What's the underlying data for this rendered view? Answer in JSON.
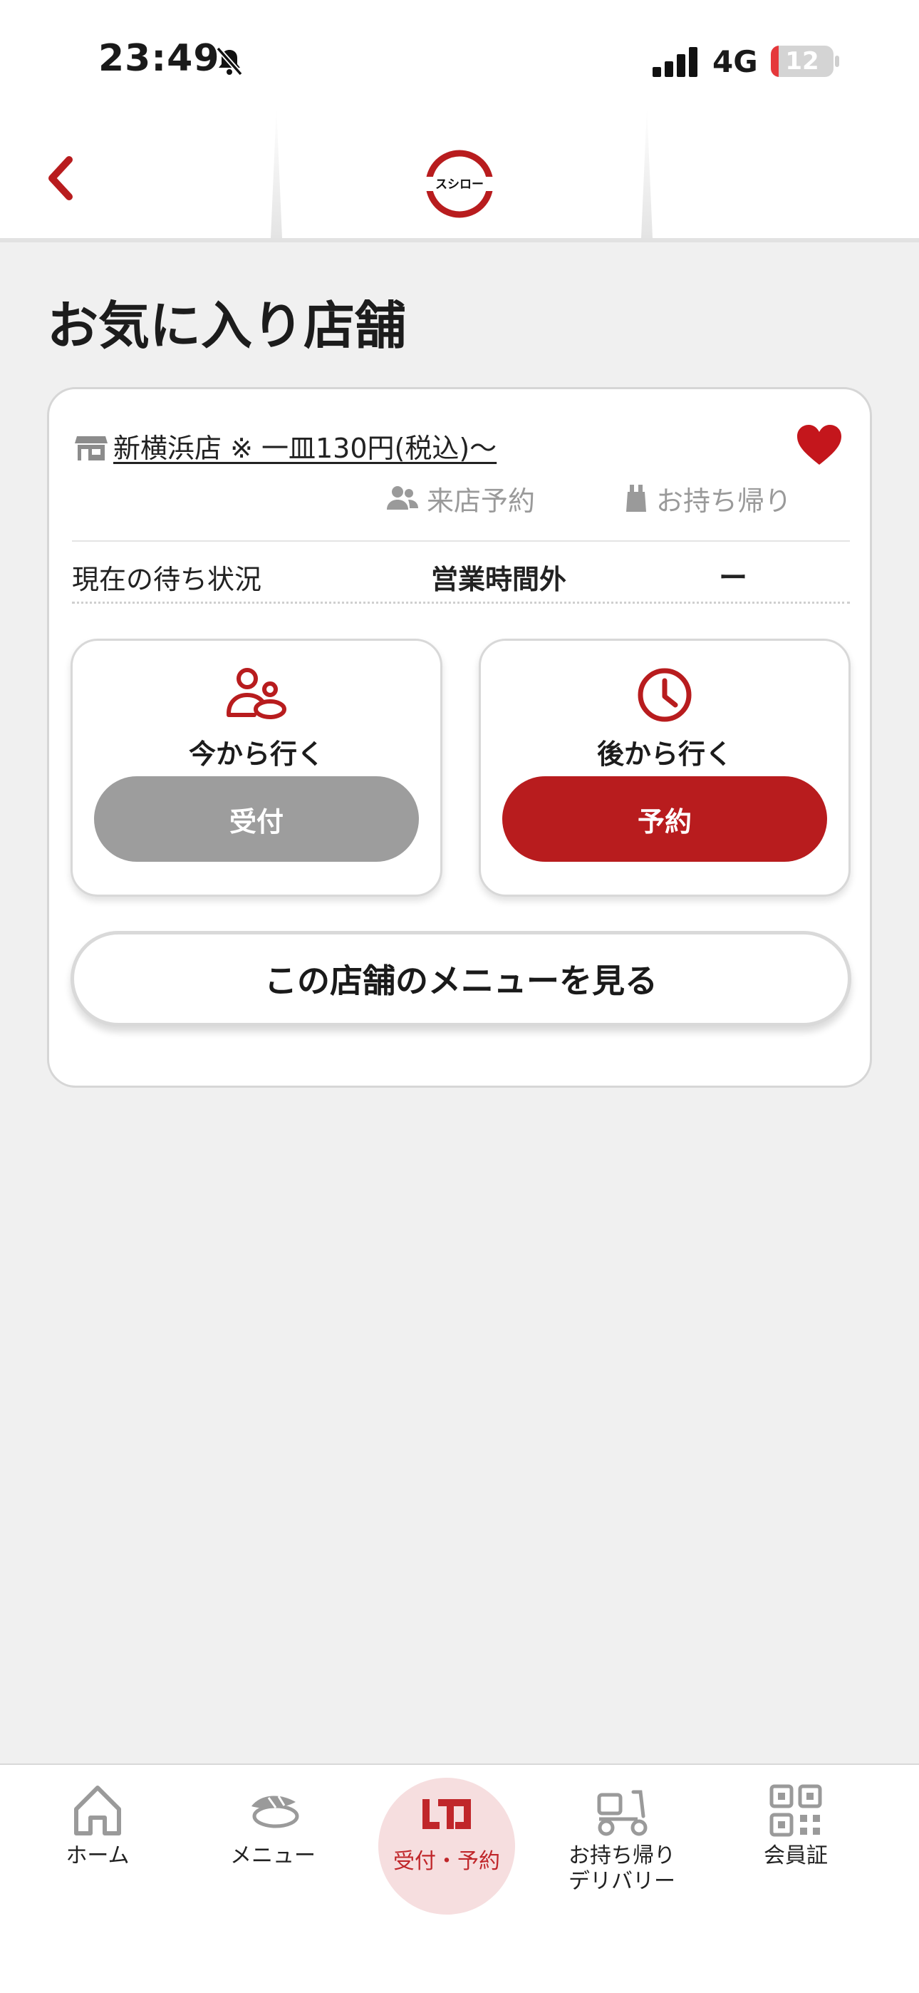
{
  "status_bar": {
    "time": "23:49",
    "network": "4G",
    "battery": "12",
    "battery_level_percent": 12
  },
  "header": {
    "logo_text": "スシロー",
    "brand_color": "#b81c1e"
  },
  "page": {
    "title": "お気に入り店舗"
  },
  "store": {
    "name": "新横浜店 ※ 一皿130円(税込)〜",
    "favorite": true,
    "services": {
      "reserve": "来店予約",
      "takeout": "お持ち帰り"
    },
    "wait": {
      "label": "現在の待ち状況",
      "status": "営業時間外",
      "value": "ー"
    },
    "actions": {
      "now_label": "今から行く",
      "now_button": "受付",
      "later_label": "後から行く",
      "later_button": "予約"
    },
    "menu_button": "この店舗のメニューを見る"
  },
  "bottom_nav": {
    "items": [
      {
        "label": "ホーム",
        "icon": "home-icon"
      },
      {
        "label": "メニュー",
        "icon": "sushi-icon"
      },
      {
        "label": "受付・予約",
        "icon": "reservation-icon",
        "active": true
      },
      {
        "label": "お持ち帰り\nデリバリー",
        "icon": "delivery-scooter-icon"
      },
      {
        "label": "会員証",
        "icon": "qr-code-icon"
      }
    ]
  }
}
